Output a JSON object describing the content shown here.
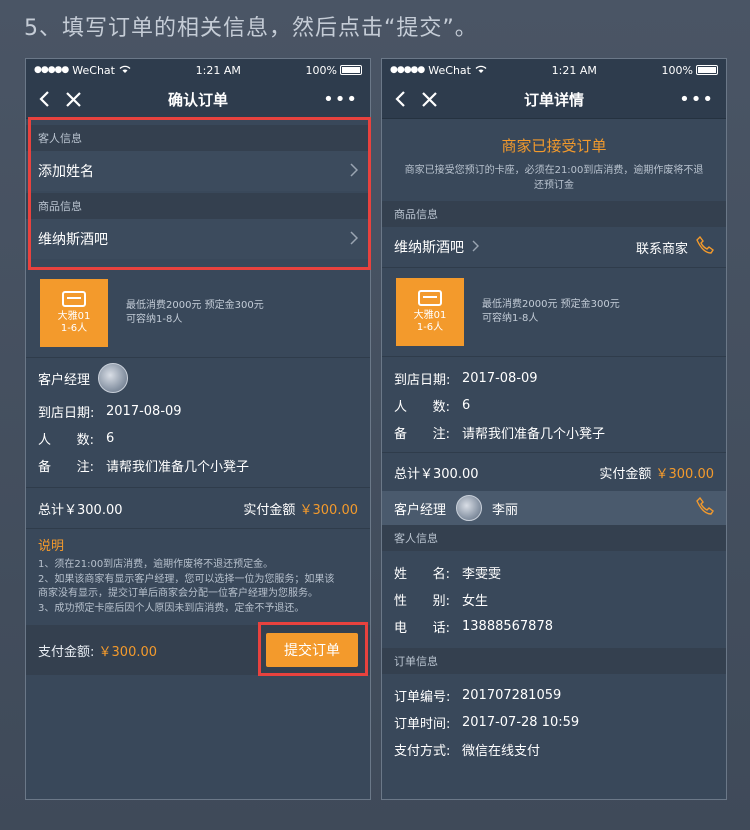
{
  "heading": "5、填写订单的相关信息，然后点击“提交”。",
  "status": {
    "carrier": "WeChat",
    "time": "1:21 AM",
    "battery": "100%"
  },
  "left": {
    "title": "确认订单",
    "guest_section": "客人信息",
    "add_name": "添加姓名",
    "product_section": "商品信息",
    "venue": "维纳斯酒吧",
    "thumb_line1": "大雅01",
    "thumb_line2": "1-6人",
    "min_spend": "最低消费2000元 预定金300元",
    "capacity": "可容纳1-8人",
    "manager_label": "客户经理",
    "date_label": "到店日期:",
    "date_value": "2017-08-09",
    "people_label_a": "人",
    "people_label_b": "数:",
    "people_value": "6",
    "remark_label_a": "备",
    "remark_label_b": "注:",
    "remark_value": "请帮我们准备几个小凳子",
    "total_label": "总计￥300.00",
    "actual_label": "实付金额",
    "actual_value": "￥300.00",
    "note_title": "说明",
    "note_1": "1、须在21:00到店消费，逾期作废将不退还预定金。",
    "note_2a": "2、如果该商家有显示客户经理，您可以选择一位为您服务；如果该",
    "note_2b": "商家没有显示，提交订单后商家会分配一位客户经理为您服务。",
    "note_3": "3、成功预定卡座后因个人原因未到店消费，定金不予退还。",
    "pay_label": "支付金额:",
    "pay_value": "￥300.00",
    "submit": "提交订单"
  },
  "right": {
    "title": "订单详情",
    "accepted": "商家已接受订单",
    "accepted_desc_1": "商家已接受您预订的卡座，必须在21:00到店消费，逾期作废将不退",
    "accepted_desc_2": "还预订金",
    "product_section": "商品信息",
    "venue": "维纳斯酒吧",
    "contact": "联系商家",
    "thumb_line1": "大雅01",
    "thumb_line2": "1-6人",
    "min_spend": "最低消费2000元 预定金300元",
    "capacity": "可容纳1-8人",
    "date_label": "到店日期:",
    "date_value": "2017-08-09",
    "people_label_a": "人",
    "people_label_b": "数:",
    "people_value": "6",
    "remark_label_a": "备",
    "remark_label_b": "注:",
    "remark_value": "请帮我们准备几个小凳子",
    "total_label": "总计￥300.00",
    "actual_label": "实付金额",
    "actual_value": "￥300.00",
    "manager_label": "客户经理",
    "manager_name": "李丽",
    "guest_section": "客人信息",
    "name_label_a": "姓",
    "name_label_b": "名:",
    "name_value": "李雯雯",
    "gender_label_a": "性",
    "gender_label_b": "别:",
    "gender_value": "女生",
    "phone_label_a": "电",
    "phone_label_b": "话:",
    "phone_value": "13888567878",
    "order_section": "订单信息",
    "order_no_label": "订单编号:",
    "order_no_value": "201707281059",
    "order_time_label": "订单时间:",
    "order_time_value": "2017-07-28  10:59",
    "pay_method_label": "支付方式:",
    "pay_method_value": "微信在线支付"
  },
  "colors": {
    "accent": "#f39a2c",
    "highlight": "#e8423e",
    "background": "#39485a"
  }
}
